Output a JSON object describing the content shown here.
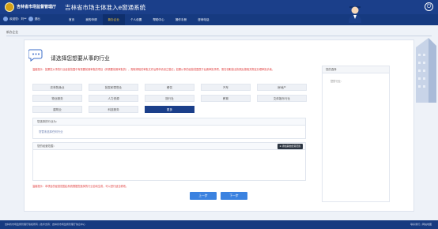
{
  "header": {
    "org_name": "吉林省市场监督管理厅",
    "title": "吉林省市场主体准入e窗通系统",
    "power_icon": "power-icon"
  },
  "nav": {
    "user_label": "欢迎您：刘**",
    "user_extra": "退出",
    "items": [
      {
        "label": "首页"
      },
      {
        "label": "我的申请"
      },
      {
        "label": "新办企业"
      },
      {
        "label": "个人设置"
      },
      {
        "label": "帮助中心"
      },
      {
        "label": "操作手册"
      },
      {
        "label": "咨询电话"
      }
    ],
    "active_index": 2
  },
  "breadcrumb": "新办企业",
  "card": {
    "title": "请选择您想要从事的行业",
    "warning": "温馨提示：如果您从事的行业经营范围中有需要前置审批的项目（即需要前置审批的），需取得相关审批文件后再申请设立登记；如果从事的经营范围属于后置审批事项，需在领取营业执照后按相关规定办理审批手续。",
    "industries": [
      "农林牧渔业",
      "批发和零售业",
      "餐饮",
      "汽车",
      "房地产",
      "物业服务",
      "人力资源",
      "旅行社",
      "教育",
      "文体娱乐行业",
      "建筑业",
      "科技服务",
      "更多"
    ],
    "selected_index": 12,
    "section1_label": "您选择的行业为：",
    "section1_value": "您暂未选择任何行业",
    "section2_label": "您的经营范围：",
    "section2_button": "添加其他经营范围",
    "note": "温馨提示：本项目的经营范围由系统根据您选择的行业自动生成，可以进行适当修改。",
    "prev_button": "上一步",
    "next_button": "下一步"
  },
  "side": {
    "head": "您的选择",
    "body": "您的行业："
  },
  "footer": {
    "left": "吉林省市场监督管理厅版权所有 | 技术支持：吉林省市场监督管理厅信息中心",
    "right": "联系我们 | 网站地图"
  },
  "colors": {
    "header_bg": "#1b3f8a",
    "nav_active": "#ffcc33",
    "primary_button": "#3b82e0",
    "warning_text": "#e03b3b"
  }
}
